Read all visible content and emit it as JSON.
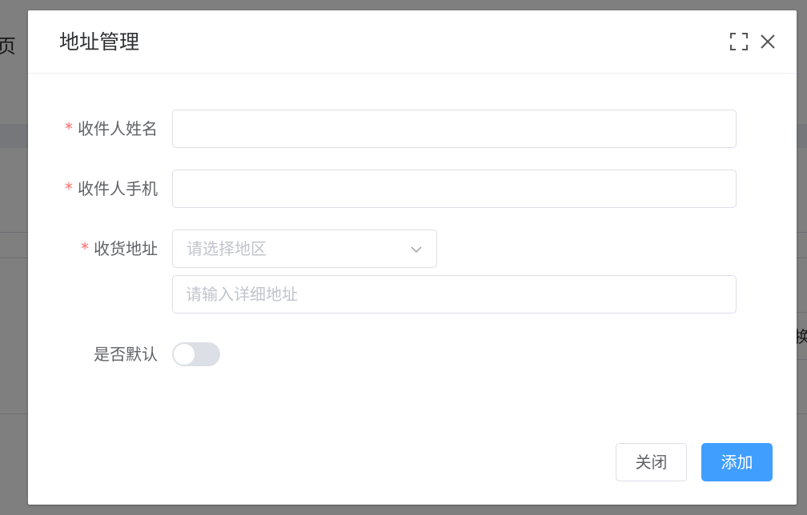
{
  "background": {
    "page_title_fragment": "页",
    "right_button_fragment": "换"
  },
  "dialog": {
    "title": "地址管理",
    "fullscreen_icon": "fullscreen-icon",
    "close_icon": "close-icon"
  },
  "form": {
    "required_mark": "*",
    "name": {
      "label": "收件人姓名",
      "value": ""
    },
    "phone": {
      "label": "收件人手机",
      "value": ""
    },
    "address": {
      "label": "收货地址",
      "region_placeholder": "请选择地区",
      "detail_placeholder": "请输入详细地址",
      "detail_value": ""
    },
    "default": {
      "label": "是否默认",
      "checked": false
    }
  },
  "footer": {
    "close_label": "关闭",
    "add_label": "添加"
  },
  "colors": {
    "primary": "#409eff",
    "required": "#f56c6c",
    "switch_off": "#dcdfe6"
  }
}
